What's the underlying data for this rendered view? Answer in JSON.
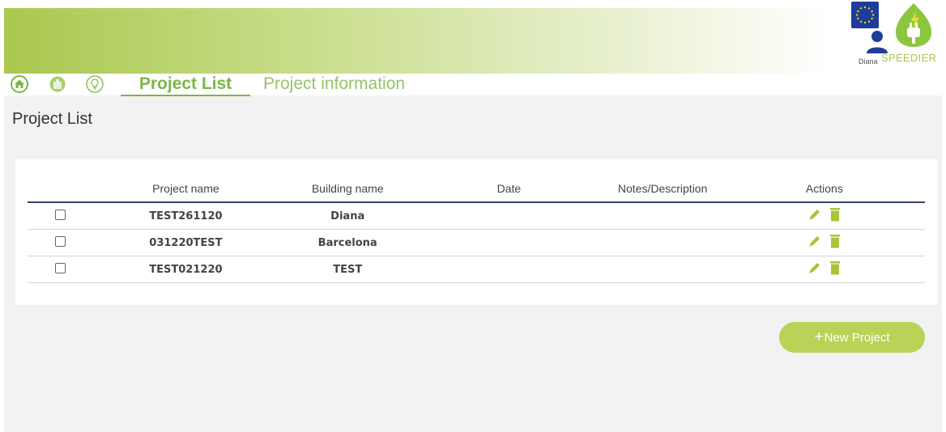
{
  "nav": {
    "home_icon": "home-icon",
    "building_icon": "building-icon",
    "bulb_icon": "lightbulb-icon",
    "active_tab": "Project List",
    "tab2": "Project information"
  },
  "header": {
    "user_name": "Diana",
    "logo_text": "SPEEDIER"
  },
  "page": {
    "title": "Project List"
  },
  "table": {
    "columns": [
      "",
      "Project name",
      "Building name",
      "Date",
      "Notes/Description",
      "Actions"
    ],
    "rows": [
      {
        "project": "TEST261120",
        "building": "Diana",
        "date": "",
        "notes": ""
      },
      {
        "project": "031220TEST",
        "building": "Barcelona",
        "date": "",
        "notes": ""
      },
      {
        "project": "TEST021220",
        "building": "TEST",
        "date": "",
        "notes": ""
      }
    ]
  },
  "actions": {
    "new_project_label": "New Project",
    "plus_glyph": "+"
  },
  "colors": {
    "brand_green": "#7ab648",
    "icon_green": "#a7c43a",
    "eu_blue": "#1e3d9a",
    "header_line": "#3a4667"
  }
}
